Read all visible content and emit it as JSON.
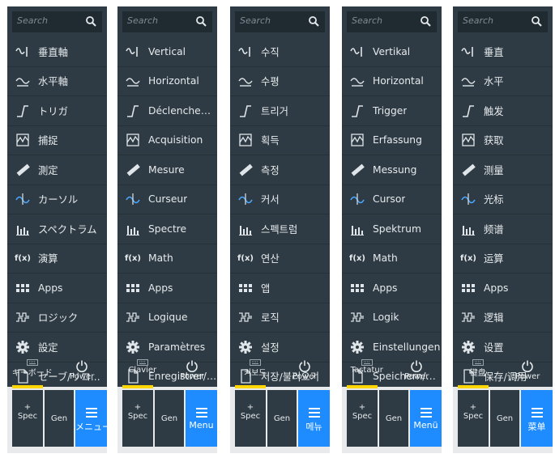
{
  "panels": [
    {
      "search_placeholder": "Search",
      "items": [
        "垂直軸",
        "水平軸",
        "トリガ",
        "捕捉",
        "測定",
        "カーソル",
        "スペクトラム",
        "演算",
        "Apps",
        "ロジック",
        "設定",
        "セーブ/リコ..."
      ],
      "math_glyph": "f(x)",
      "keypad_label": "キーボード",
      "power_label": "Power",
      "spec_label": "Spec",
      "spec_plus": "+",
      "gen_label": "Gen",
      "menu_label": "メニュー"
    },
    {
      "search_placeholder": "Search",
      "items": [
        "Vertical",
        "Horizontal",
        "Déclenchem...",
        "Acquisition",
        "Mesure",
        "Curseur",
        "Spectre",
        "Math",
        "Apps",
        "Logique",
        "Paramètres",
        "Enregistrer/c..."
      ],
      "math_glyph": "f(x)",
      "keypad_label": "Clavier",
      "power_label": "Power",
      "spec_label": "Spec",
      "spec_plus": "+",
      "gen_label": "Gen",
      "menu_label": "Menu"
    },
    {
      "search_placeholder": "Search",
      "items": [
        "수직",
        "수평",
        "트리거",
        "획득",
        "측정",
        "커서",
        "스펙트럼",
        "연산",
        "앱",
        "로직",
        "설정",
        "저장/불러오기"
      ],
      "math_glyph": "f(x)",
      "keypad_label": "키보드",
      "power_label": "Power",
      "spec_label": "Spec",
      "spec_plus": "+",
      "gen_label": "Gen",
      "menu_label": "메뉴"
    },
    {
      "search_placeholder": "Search",
      "items": [
        "Vertikal",
        "Horizontal",
        "Trigger",
        "Erfassung",
        "Messung",
        "Cursor",
        "Spektrum",
        "Math",
        "Apps",
        "Logik",
        "Einstellungen",
        "Speichern/A..."
      ],
      "math_glyph": "f(x)",
      "keypad_label": "Tastatur",
      "power_label": "Power",
      "spec_label": "Spec",
      "spec_plus": "+",
      "gen_label": "Gen",
      "menu_label": "Menü"
    },
    {
      "search_placeholder": "Search",
      "items": [
        "垂直",
        "水平",
        "触发",
        "获取",
        "测量",
        "光标",
        "频谱",
        "运算",
        "Apps",
        "逻辑",
        "设置",
        "保存/调用"
      ],
      "math_glyph": "f(x)",
      "keypad_label": "键盘",
      "power_label": "Power",
      "spec_label": "Spec",
      "spec_plus": "+",
      "gen_label": "Gen",
      "menu_label": "菜单"
    }
  ],
  "icons": [
    "vertical-icon",
    "horizontal-icon",
    "trigger-icon",
    "acquisition-icon",
    "measure-icon",
    "cursor-icon",
    "spectrum-icon",
    "math-icon",
    "apps-icon",
    "logic-icon",
    "settings-icon",
    "save-recall-icon"
  ],
  "colors": {
    "panel_bg": "#2e3b44",
    "accent_blue": "#1e8cff",
    "indicator_yellow": "#ffd600"
  }
}
